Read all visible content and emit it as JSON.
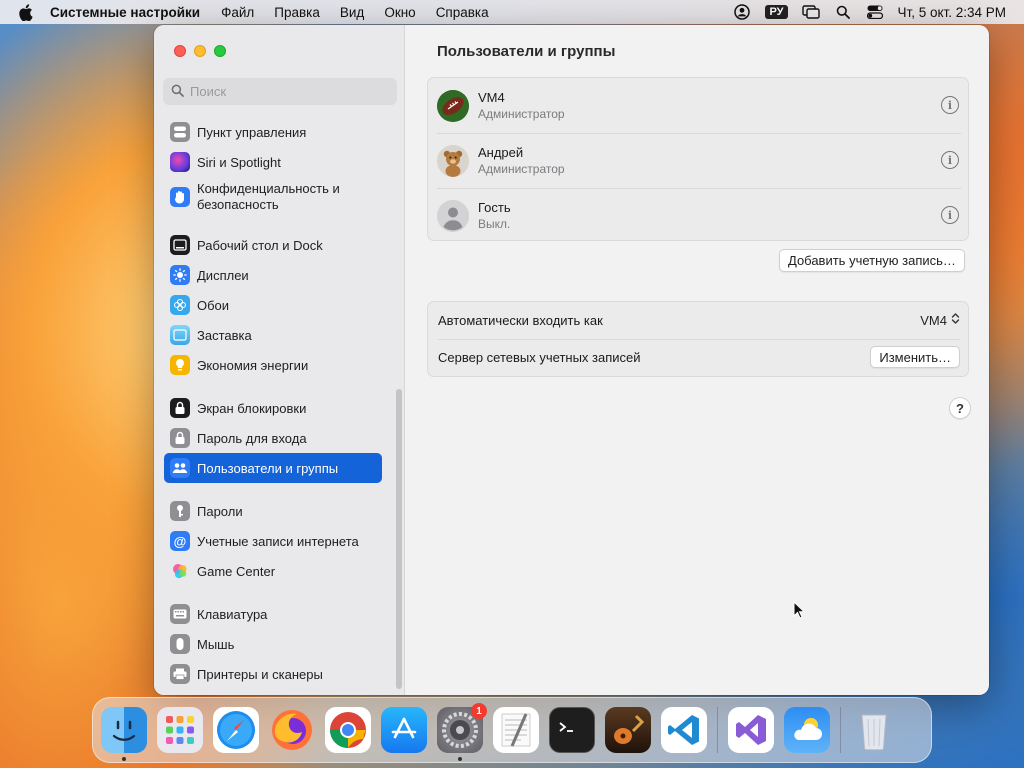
{
  "menubar": {
    "app_name": "Системные настройки",
    "menus": [
      "Файл",
      "Правка",
      "Вид",
      "Окно",
      "Справка"
    ],
    "input_source": "РУ",
    "datetime": "Чт, 5 окт.  2:34 PM"
  },
  "sidebar": {
    "search_placeholder": "Поиск",
    "items": [
      {
        "label": "Пункт управления",
        "icon": "control-center-icon",
        "color": "#8e8e93"
      },
      {
        "label": "Siri и Spotlight",
        "icon": "siri-icon",
        "color": "#7a3fe0"
      },
      {
        "label": "Конфиденциальность и безопасность",
        "icon": "privacy-hand-icon",
        "color": "#2f7cf6"
      },
      {
        "label": "Рабочий стол и Dock",
        "icon": "desktop-dock-icon",
        "color": "#1c1c1e"
      },
      {
        "label": "Дисплеи",
        "icon": "displays-icon",
        "color": "#2f7cf6"
      },
      {
        "label": "Обои",
        "icon": "wallpaper-icon",
        "color": "#35a8f0"
      },
      {
        "label": "Заставка",
        "icon": "screensaver-icon",
        "color": "#5ac8fa"
      },
      {
        "label": "Экономия энергии",
        "icon": "energy-icon",
        "color": "#f7b500"
      },
      {
        "label": "Экран блокировки",
        "icon": "lock-screen-icon",
        "color": "#1c1c1e"
      },
      {
        "label": "Пароль для входа",
        "icon": "login-password-icon",
        "color": "#8e8e93"
      },
      {
        "label": "Пользователи и группы",
        "icon": "users-groups-icon",
        "color": "#2f7cf6"
      },
      {
        "label": "Пароли",
        "icon": "passwords-icon",
        "color": "#8e8e93"
      },
      {
        "label": "Учетные записи интернета",
        "icon": "internet-accounts-icon",
        "color": "#2f7cf6"
      },
      {
        "label": "Game Center",
        "icon": "game-center-icon",
        "color": "#ffffff"
      },
      {
        "label": "Клавиатура",
        "icon": "keyboard-icon",
        "color": "#8e8e93"
      },
      {
        "label": "Мышь",
        "icon": "mouse-icon",
        "color": "#8e8e93"
      },
      {
        "label": "Принтеры и сканеры",
        "icon": "printers-icon",
        "color": "#8e8e93"
      }
    ]
  },
  "main": {
    "title": "Пользователи и группы",
    "users": [
      {
        "name": "VM4",
        "role": "Администратор",
        "avatar": "football-avatar"
      },
      {
        "name": "Андрей",
        "role": "Администратор",
        "avatar": "teddy-bear-avatar"
      },
      {
        "name": "Гость",
        "role": "Выкл.",
        "avatar": "guest-avatar"
      }
    ],
    "add_account_label": "Добавить учетную запись…",
    "auto_login_label": "Автоматически входить как",
    "auto_login_value": "VM4",
    "network_server_label": "Сервер сетевых учетных записей",
    "change_label": "Изменить…",
    "help_label": "?"
  },
  "dock": {
    "apps": [
      {
        "name": "finder",
        "running": true
      },
      {
        "name": "launchpad",
        "running": false
      },
      {
        "name": "safari",
        "running": false
      },
      {
        "name": "firefox",
        "running": false
      },
      {
        "name": "chrome",
        "running": false
      },
      {
        "name": "app-store",
        "running": false
      },
      {
        "name": "system-settings",
        "running": true,
        "badge": "1"
      },
      {
        "name": "textedit",
        "running": false
      },
      {
        "name": "terminal",
        "running": false
      },
      {
        "name": "garageband",
        "running": false
      },
      {
        "name": "vscode",
        "running": false
      },
      {
        "name": "visual-studio",
        "running": false
      },
      {
        "name": "weather",
        "running": false
      },
      {
        "name": "trash",
        "running": false
      }
    ]
  }
}
